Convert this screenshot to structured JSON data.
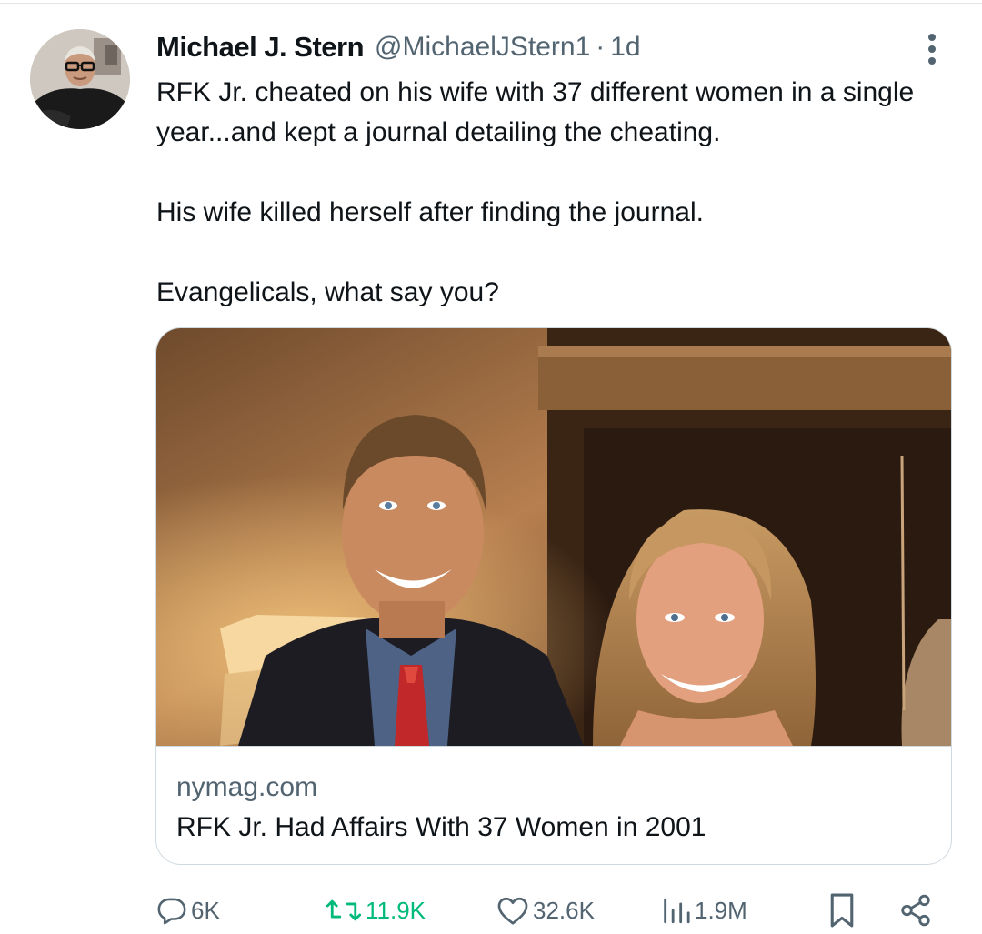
{
  "tweet": {
    "author": {
      "display_name": "Michael J. Stern",
      "handle": "@MichaelJStern1",
      "time_separator": "·",
      "time": "1d",
      "avatar_icon": "profile-photo"
    },
    "text": {
      "p1": "RFK Jr. cheated on his wife with 37 different women in a single year...and kept a journal detailing the cheating.",
      "p2": "His wife killed herself after finding the journal.",
      "p3": "Evangelicals, what say you?"
    },
    "card": {
      "domain": "nymag.com",
      "title": "RFK Jr. Had Affairs With 37 Women in 2001"
    },
    "actions": {
      "replies": "6K",
      "retweets": "11.9K",
      "likes": "32.6K",
      "views": "1.9M"
    },
    "icons": {
      "more": "more-vertical-icon",
      "reply": "reply-icon",
      "retweet": "retweet-icon",
      "like": "heart-icon",
      "views": "views-icon",
      "bookmark": "bookmark-icon",
      "share": "share-icon"
    },
    "colors": {
      "text": "#0f1419",
      "secondary": "#536471",
      "retweet_active": "#00ba7c",
      "border": "#cfd9de"
    }
  }
}
